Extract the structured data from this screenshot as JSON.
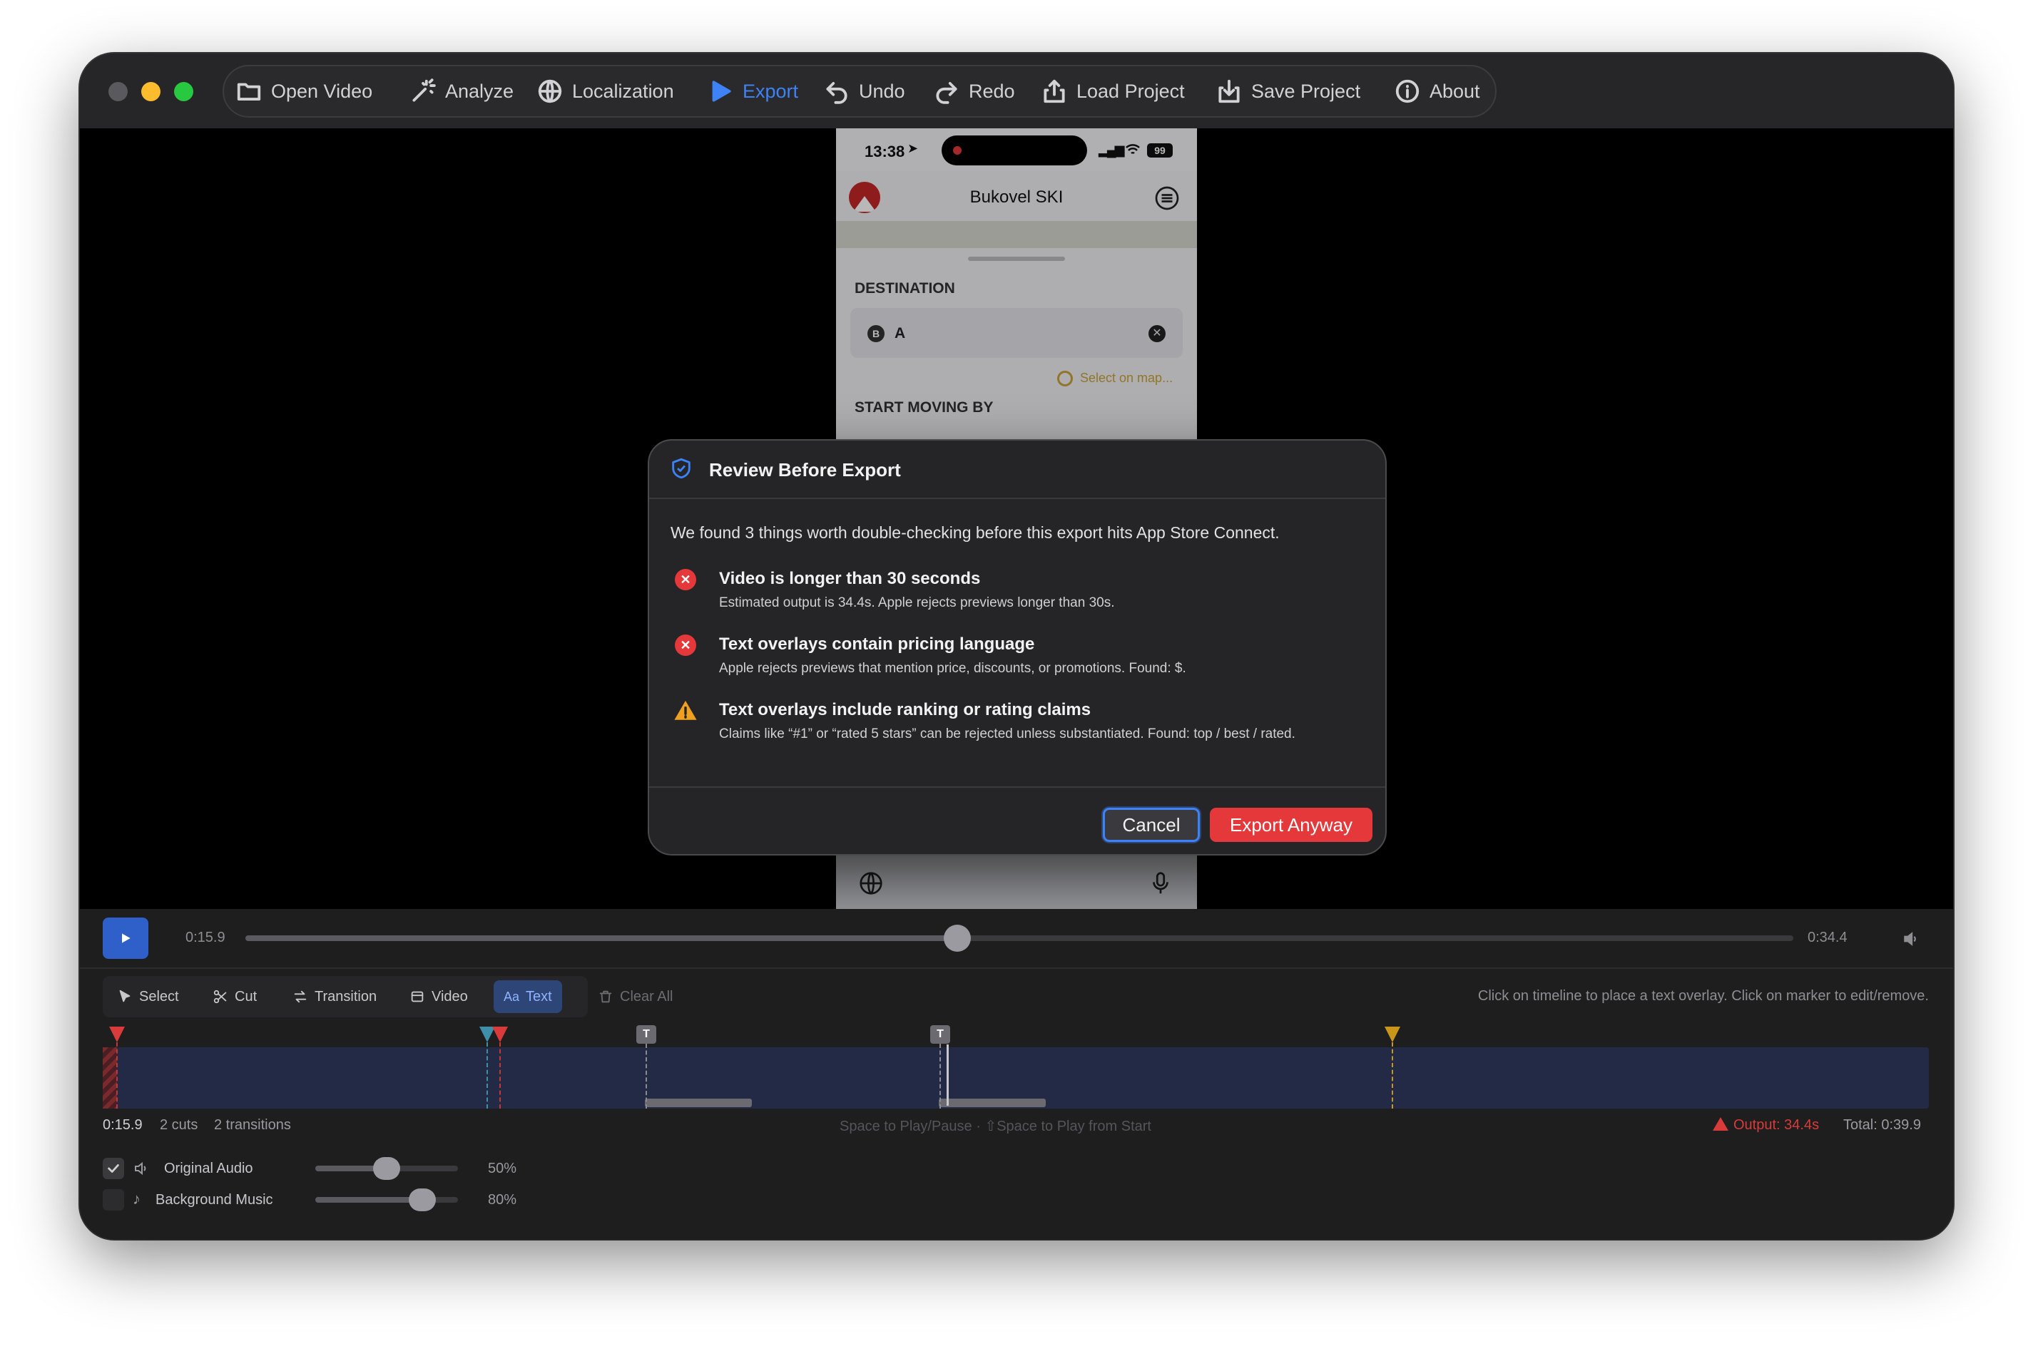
{
  "toolbar": {
    "open_video": "Open Video",
    "analyze": "Analyze",
    "localization": "Localization",
    "export": "Export",
    "undo": "Undo",
    "redo": "Redo",
    "load_project": "Load Project",
    "save_project": "Save Project",
    "about": "About"
  },
  "phone": {
    "time": "13:38",
    "battery": "99",
    "app_title": "Bukovel SKI",
    "destination_label": "DESTINATION",
    "destination_badge": "B",
    "destination_value": "A",
    "select_on_map": "Select on map...",
    "start_moving_label": "START MOVING BY"
  },
  "modal": {
    "title": "Review Before Export",
    "intro": "We found 3 things worth double-checking before this export hits App Store Connect.",
    "issues": [
      {
        "severity": "error",
        "title": "Video is longer than 30 seconds",
        "description": "Estimated output is 34.4s. Apple rejects previews longer than 30s."
      },
      {
        "severity": "error",
        "title": "Text overlays contain pricing language",
        "description": "Apple rejects previews that mention price, discounts, or promotions. Found: $."
      },
      {
        "severity": "warning",
        "title": "Text overlays include ranking or rating claims",
        "description": "Claims like “#1” or “rated 5 stars” can be rejected unless substantiated. Found: top / best / rated."
      }
    ],
    "cancel_label": "Cancel",
    "export_anyway_label": "Export Anyway"
  },
  "playback": {
    "current_time": "0:15.9",
    "total_time": "0:34.4",
    "progress_fraction": 0.46
  },
  "edit_tools": {
    "select": "Select",
    "cut": "Cut",
    "transition": "Transition",
    "video": "Video",
    "text": "Text",
    "clear_all": "Clear All",
    "hint": "Click on timeline to place a text overlay. Click on marker to edit/remove."
  },
  "timeline": {
    "marker_label": "T",
    "status_time": "0:15.9",
    "cuts": "2 cuts",
    "transitions": "2 transitions",
    "shortcuts": "Space to Play/Pause · ⇧Space to Play from Start",
    "output": "Output: 34.4s",
    "total": "Total: 0:39.9"
  },
  "audio": {
    "original_label": "Original Audio",
    "original_level": "50%",
    "original_level_fraction": 0.5,
    "original_enabled": true,
    "music_label": "Background Music",
    "music_level": "80%",
    "music_level_fraction": 0.8,
    "music_enabled": false
  },
  "colors": {
    "accent": "#3d82f6",
    "danger": "#e5383b",
    "warning": "#f0a020",
    "timeline_track": "#232a45"
  }
}
